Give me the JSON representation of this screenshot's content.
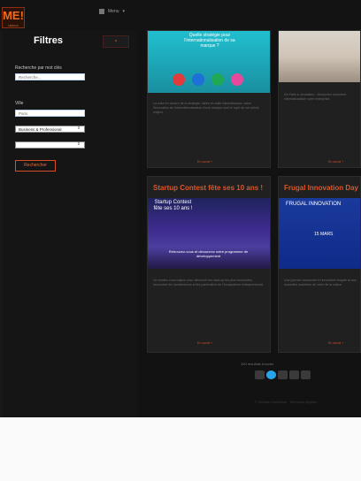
{
  "brand": {
    "logo_text": "ME!",
    "logo_subtext": "MÉDIAS"
  },
  "topbar": {
    "menu_label": "Menu",
    "menu_caret": "▾"
  },
  "filters": {
    "title": "Filtres",
    "toggle_label": "×",
    "keyword_label": "Recherche par mot clés",
    "keyword_placeholder": "Recherche...",
    "city_label": "Ville",
    "city_value": "Paris",
    "sector_value": "Business & Professional",
    "secondary_value": "",
    "caret": "⇕",
    "search_button": "Rechercher"
  },
  "cards": [
    {
      "image_caption": "Quelle stratégie pour l'internationalisation de sa marque ?",
      "excerpt": "La mise en oeuvre de la stratégie, idées et outils internationaux, selon l'innovation de l'internationalisation d'une marque sont le sujet de cet article majeur.",
      "read_more": "En savoir +"
    },
    {
      "excerpt": "De Paris à Jérusalem : découvrez comment internationaliser votre entreprise.",
      "read_more": "En savoir +"
    },
    {
      "title": "Startup Contest fête ses 10 ans !",
      "image_caption": "Startup Contest fête ses 10 ans !",
      "image_subcaption": "Retrouvez-vous et découvrez notre programme de développement",
      "excerpt": "Un rendez-vous majeur pour découvrir les start-up les plus innovantes, rencontrer les investisseurs et les partenaires de l'écosystème entrepreneurial.",
      "read_more": "En savoir +"
    },
    {
      "title": "Frugal Innovation Day",
      "image_caption": "FRUGAL INNOVATION",
      "image_date": "15 MARS",
      "excerpt": "Une journée consacrée à l'innovation frugale et aux nouvelles manières de créer de la valeur.",
      "read_more": "En savoir +"
    }
  ],
  "pagination": {
    "results_label": "100 résultats trouvés"
  },
  "footer": {
    "text": "© Médias Entreprise · Mentions légales"
  }
}
